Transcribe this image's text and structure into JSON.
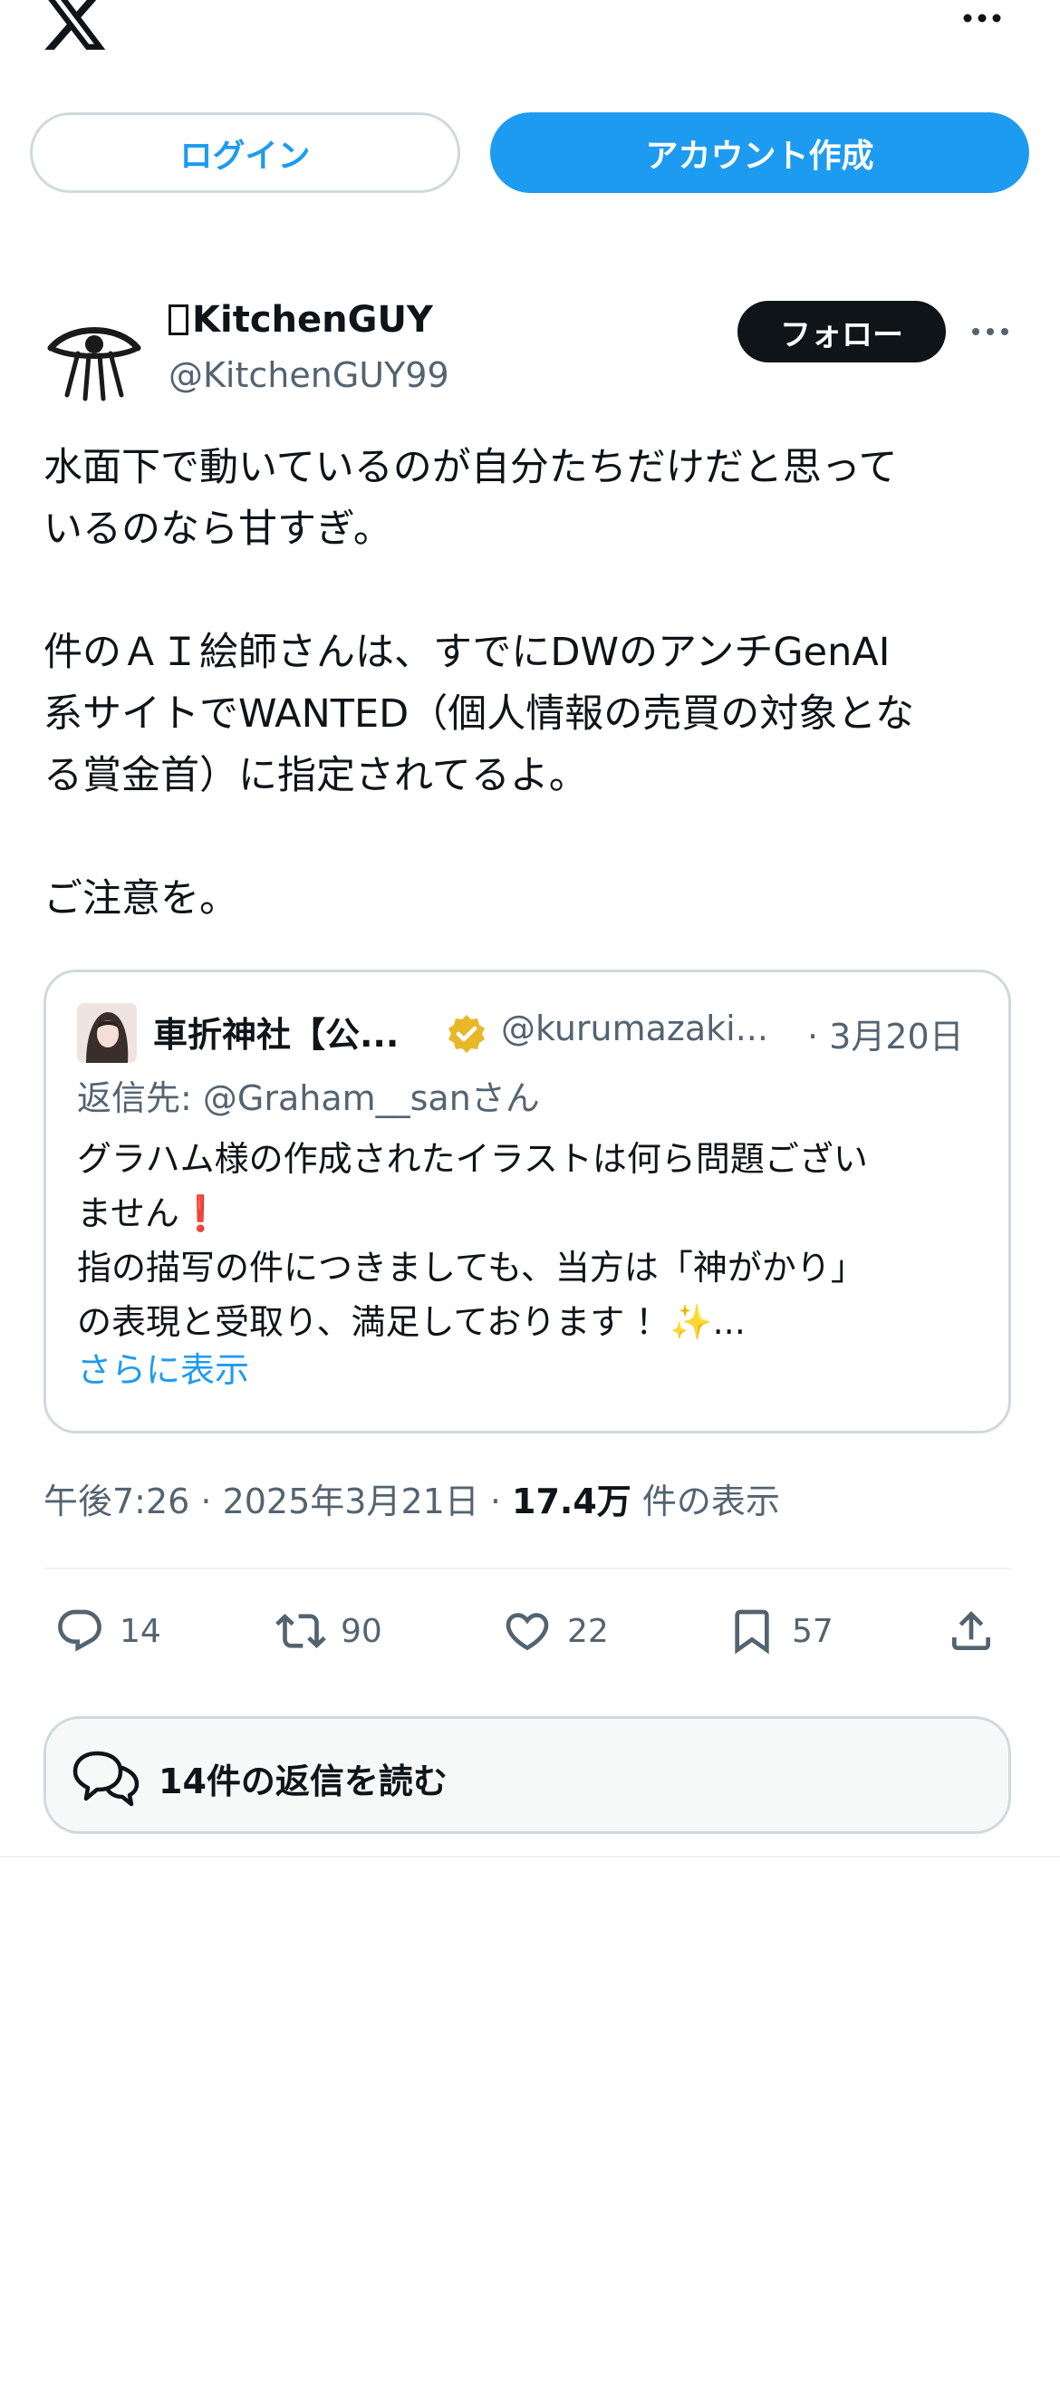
{
  "top_bar": {
    "logo_icon": "x-logo-icon",
    "more_icon": "more-horizontal-icon"
  },
  "auth": {
    "login_label": "ログイン",
    "signup_label": "アカウント作成"
  },
  "post": {
    "display_name": "KitchenGUY",
    "handle": "@KitchenGUY99",
    "follow_label": "フォロー",
    "body": "水面下で動いているのが自分たちだけだと思って\nいるのなら甘すぎ。\n\n件のＡＩ絵師さんは、すでにDWのアンチGenAI\n系サイトでWANTED（個人情報の売買の対象とな\nる賞金首）に指定されてるよ。\n\nご注意を。"
  },
  "quote": {
    "name": "車折神社【公...",
    "handle": "@kurumazaki...",
    "date": "· 3月20日",
    "reply_to": "返信先: @Graham__sanさん",
    "body": "グラハム様の作成されたイラストは何ら問題ござい\nません❗\n指の描写の件につきましても、当方は「神がかり」\nの表現と受取り、満足しております ！✨...",
    "show_more": "さらに表示",
    "badge_icon": "verified-gold-badge-icon"
  },
  "meta": {
    "time_date": "午後7:26 · 2025年3月21日 · ",
    "views_count": "17.4万",
    "views_label": " 件の表示"
  },
  "actions": {
    "replies": "14",
    "reposts": "90",
    "likes": "22",
    "bookmarks": "57"
  },
  "read_replies": {
    "label": "14件の返信を読む"
  },
  "colors": {
    "accent": "#1d9bf0",
    "text_primary": "#0f1419",
    "text_secondary": "#536471",
    "border": "#cfd9de",
    "gold_badge": "#e8b829"
  }
}
